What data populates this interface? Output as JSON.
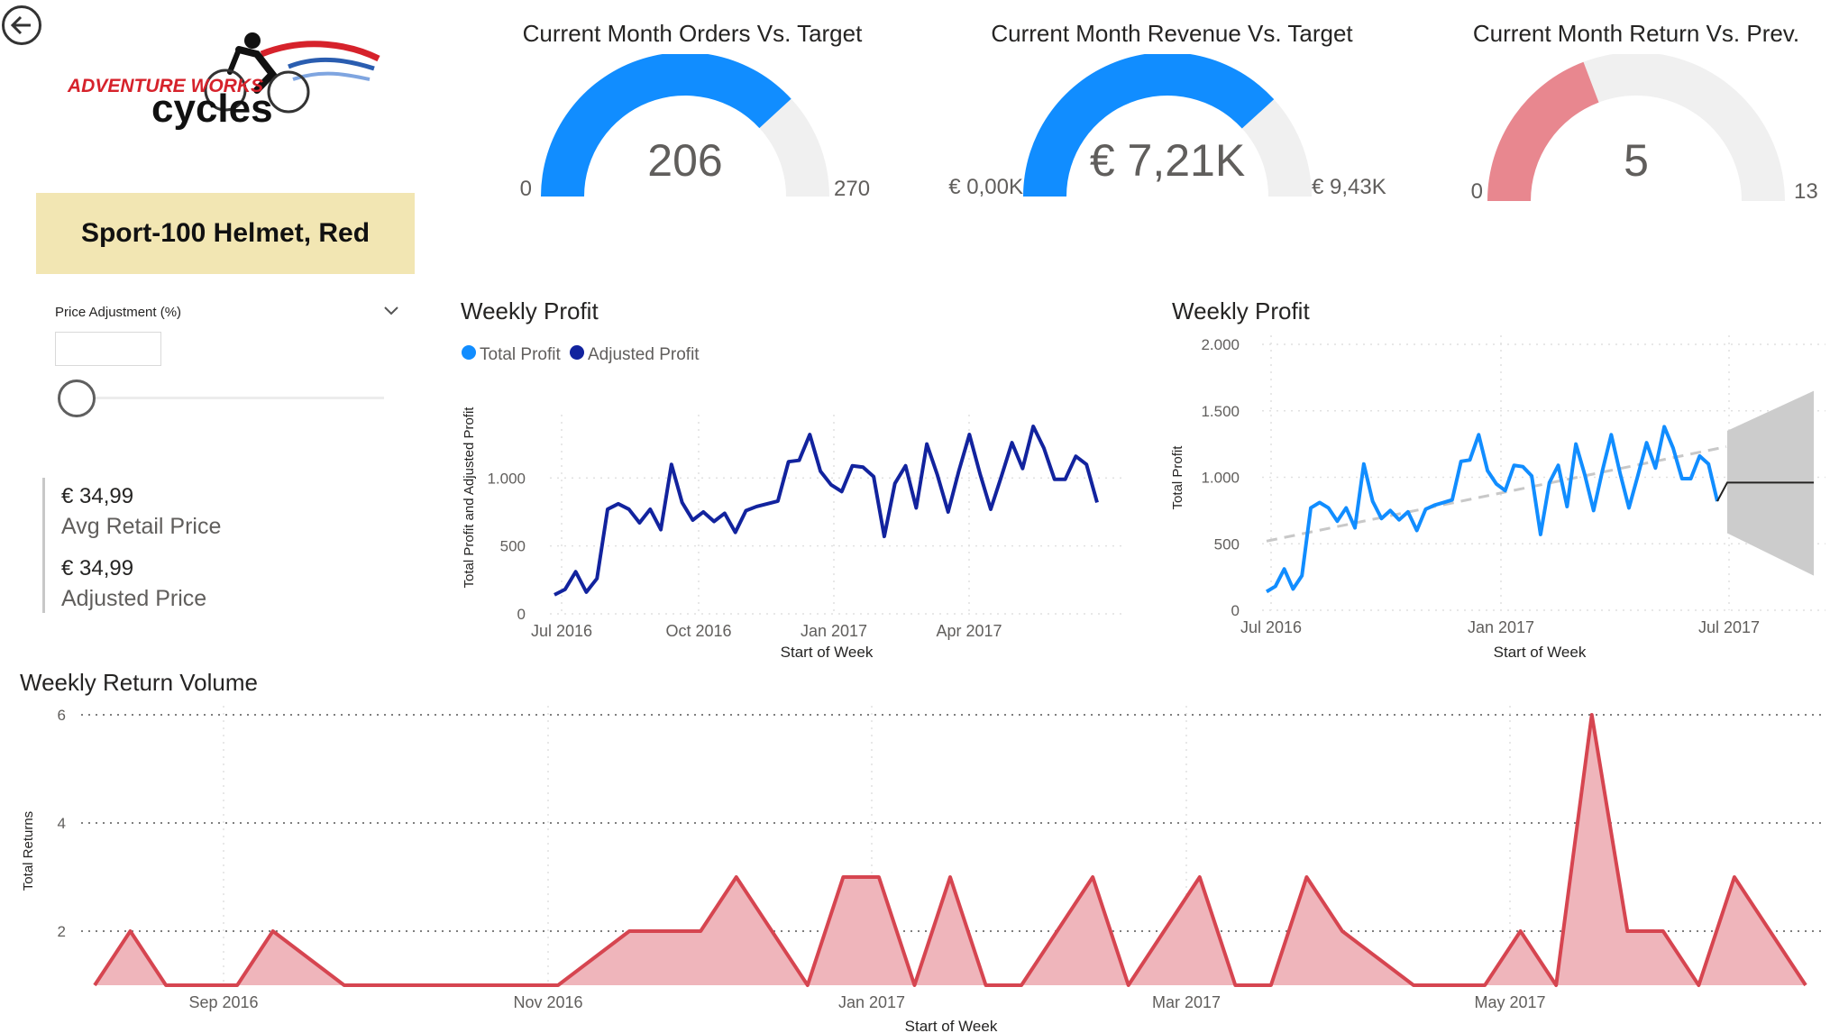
{
  "logo": {
    "top_text": "ADVENTURE WORKS",
    "bottom_text": "cycles"
  },
  "product": {
    "name": "Sport-100 Helmet, Red"
  },
  "slicer": {
    "title": "Price Adjustment (%)",
    "value": ""
  },
  "cards": [
    {
      "value": "€ 34,99",
      "label": "Avg Retail Price"
    },
    {
      "value": "€ 34,99",
      "label": "Adjusted Price"
    }
  ],
  "gauges": [
    {
      "title": "Current Month Orders Vs. Target",
      "value_label": "206",
      "min_label": "0",
      "max_label": "270",
      "value": 206,
      "max": 270,
      "color": "#118DFF"
    },
    {
      "title": "Current Month Revenue Vs. Target",
      "value_label": "€ 7,21K",
      "min_label": "€ 0,00K",
      "max_label": "€ 9,43K",
      "value": 7.21,
      "max": 9.43,
      "color": "#118DFF"
    },
    {
      "title": "Current Month Return Vs. Prev.",
      "value_label": "5",
      "min_label": "0",
      "max_label": "13",
      "value": 5,
      "max": 13,
      "color": "#E8878F"
    }
  ],
  "chart_data": [
    {
      "type": "line",
      "title": "Weekly Profit",
      "legend": [
        "Total Profit",
        "Adjusted Profit"
      ],
      "legend_colors": [
        "#118DFF",
        "#12239E"
      ],
      "legend_position": "top-left",
      "xlabel": "Start of Week",
      "ylabel": "Total Profit and Adjusted Profit",
      "x_ticks": [
        "Jul 2016",
        "Oct 2016",
        "Jan 2017",
        "Apr 2017"
      ],
      "y_ticks": [
        "0",
        "500",
        "1.000"
      ],
      "ylim": [
        0,
        1400
      ],
      "grid": true,
      "series": [
        {
          "name": "Adjusted Profit",
          "color": "#12239E",
          "values": [
            140,
            180,
            310,
            160,
            260,
            770,
            810,
            770,
            670,
            770,
            620,
            1100,
            820,
            690,
            750,
            680,
            740,
            600,
            760,
            790,
            810,
            830,
            1120,
            1130,
            1320,
            1050,
            950,
            900,
            1090,
            1080,
            1010,
            570,
            960,
            1090,
            780,
            1250,
            1020,
            750,
            1050,
            1320,
            1030,
            770,
            1010,
            1260,
            1070,
            1380,
            1220,
            990,
            990,
            1160,
            1100,
            820
          ]
        }
      ]
    },
    {
      "type": "line",
      "title": "Weekly Profit",
      "xlabel": "Start of Week",
      "ylabel": "Total Profit",
      "x_ticks": [
        "Jul 2016",
        "Jan 2017",
        "Jul 2017"
      ],
      "y_ticks": [
        "0",
        "500",
        "1.000",
        "1.500",
        "2.000"
      ],
      "ylim": [
        0,
        2000
      ],
      "grid": true,
      "series": [
        {
          "name": "Total Profit",
          "color": "#118DFF",
          "values": [
            140,
            180,
            310,
            160,
            260,
            770,
            810,
            770,
            670,
            770,
            620,
            1100,
            820,
            690,
            750,
            680,
            740,
            600,
            760,
            790,
            810,
            830,
            1120,
            1130,
            1320,
            1050,
            950,
            900,
            1090,
            1080,
            1010,
            570,
            960,
            1090,
            780,
            1250,
            1020,
            750,
            1050,
            1320,
            1030,
            770,
            1010,
            1260,
            1070,
            1380,
            1220,
            990,
            990,
            1160,
            1100,
            820
          ]
        }
      ],
      "forecast": {
        "value": 960,
        "upper_start": 1350,
        "upper_end": 1650,
        "lower_start": 580,
        "lower_end": 260
      }
    },
    {
      "type": "area",
      "title": "Weekly Return Volume",
      "xlabel": "Start of Week",
      "ylabel": "Total Returns",
      "x_ticks": [
        "Sep 2016",
        "Nov 2016",
        "Jan 2017",
        "Mar 2017",
        "May 2017"
      ],
      "y_ticks": [
        "2",
        "4",
        "6"
      ],
      "ylim": [
        1,
        6
      ],
      "grid": true,
      "series": [
        {
          "name": "Total Returns",
          "color": "#D64550",
          "values": [
            1,
            2,
            1,
            1,
            1,
            2,
            1.5,
            1,
            1,
            1,
            1,
            1,
            1,
            1,
            1.5,
            2,
            2,
            2,
            3,
            2,
            1,
            3,
            3,
            1,
            3,
            1,
            1,
            2,
            3,
            1,
            2,
            3,
            1,
            1,
            3,
            2,
            1.5,
            1,
            1,
            1,
            2,
            1,
            6,
            2,
            2,
            1,
            3,
            2,
            1
          ]
        }
      ]
    }
  ]
}
